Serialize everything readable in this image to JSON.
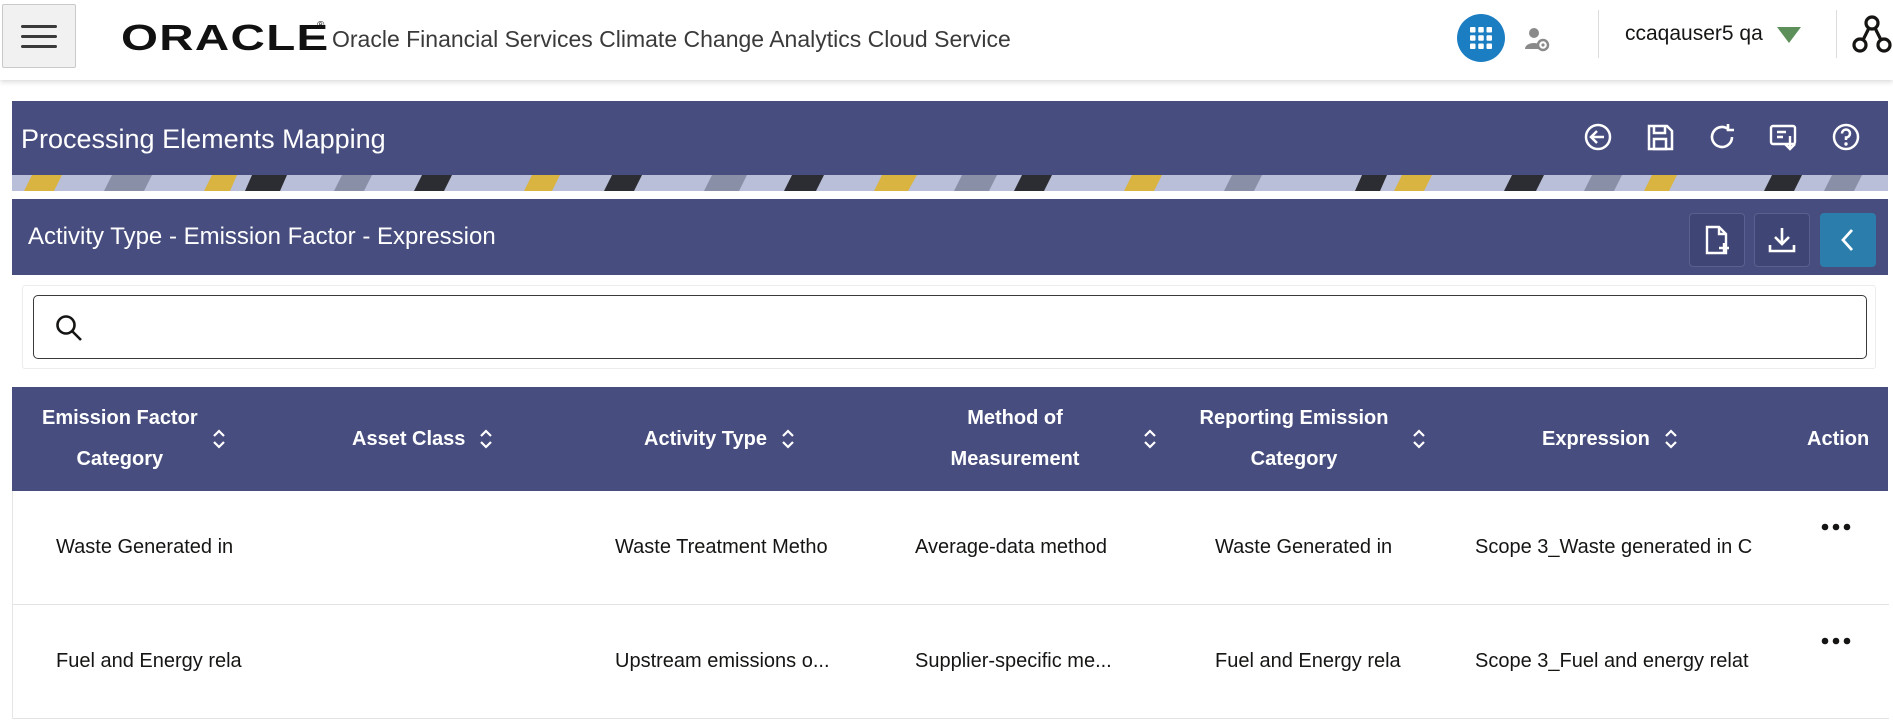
{
  "header": {
    "logo_text": "ORACLE",
    "logo_mark": "®",
    "product_title": "Oracle Financial Services Climate Change Analytics Cloud Service",
    "user_name": "ccaqauser5 qa",
    "icons": [
      "hamburger-icon",
      "apps-grid-icon",
      "user-settings-icon",
      "caret-down-icon",
      "hierarchy-icon"
    ],
    "accent_color": "#1c7ec2"
  },
  "page": {
    "title": "Processing Elements Mapping",
    "actions": [
      "back-icon",
      "save-icon",
      "refresh-icon",
      "export-icon",
      "help-icon"
    ]
  },
  "panel": {
    "title": "Activity Type - Emission Factor - Expression",
    "actions": [
      "new-document-icon",
      "download-icon",
      "collapse-icon"
    ]
  },
  "search": {
    "placeholder": "",
    "value": ""
  },
  "table": {
    "columns": [
      {
        "line1": "Emission Factor",
        "line2": "Category",
        "sortable": true
      },
      {
        "line1": "Asset Class",
        "line2": "",
        "sortable": true
      },
      {
        "line1": "Activity Type",
        "line2": "",
        "sortable": true
      },
      {
        "line1": "Method of",
        "line2": "Measurement",
        "sortable": true
      },
      {
        "line1": "Reporting Emission",
        "line2": "Category",
        "sortable": true
      },
      {
        "line1": "Expression",
        "line2": "",
        "sortable": true
      },
      {
        "line1": "Action",
        "line2": "",
        "sortable": false
      }
    ],
    "rows": [
      {
        "emission_factor_category": "Waste Generated in",
        "asset_class": "",
        "activity_type": "Waste Treatment Metho",
        "method_of_measurement": "Average-data method",
        "reporting_emission_category": "Waste Generated in",
        "expression": "Scope 3_Waste generated in C"
      },
      {
        "emission_factor_category": "Fuel and Energy rela",
        "asset_class": "",
        "activity_type": "Upstream emissions o...",
        "method_of_measurement": "Supplier-specific me...",
        "reporting_emission_category": "Fuel and Energy rela",
        "expression": "Scope 3_Fuel and energy relat"
      }
    ]
  },
  "colors": {
    "header_band": "#474d7e",
    "collapse_button": "#2b7eab"
  }
}
